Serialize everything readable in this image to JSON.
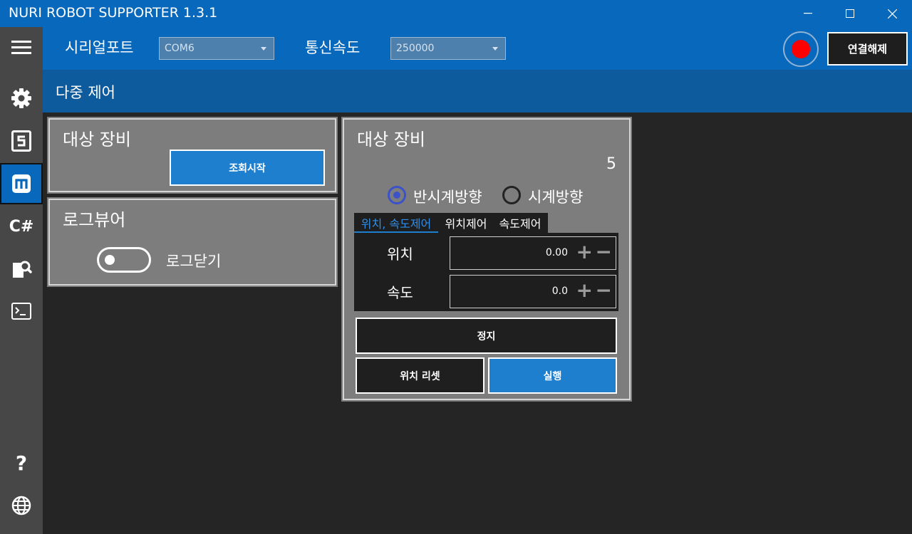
{
  "app": {
    "title": "NURI ROBOT SUPPORTER 1.3.1"
  },
  "window_controls": {
    "minimize": "—",
    "maximize": "☐",
    "close": "✕"
  },
  "sidebar": {
    "items": [
      {
        "name": "menu-icon",
        "glyph": "☰"
      },
      {
        "name": "gear-icon",
        "glyph": "⚙"
      },
      {
        "name": "s-icon",
        "glyph": "S"
      },
      {
        "name": "m-icon",
        "glyph": "m"
      },
      {
        "name": "csharp-icon",
        "glyph": "C#"
      },
      {
        "name": "file-search-icon",
        "glyph": "🔍"
      },
      {
        "name": "terminal-icon",
        "glyph": ">_"
      },
      {
        "name": "help-icon",
        "glyph": "?"
      },
      {
        "name": "globe-icon",
        "glyph": "🌐"
      }
    ],
    "active_index": 3,
    "csharp_label": "C#",
    "help_label": "?"
  },
  "connection": {
    "serial_port_label": "시리얼포트",
    "serial_port_value": "COM6",
    "baud_label": "통신속도",
    "baud_value": "250000",
    "status_color": "#ff0000",
    "disconnect_label": "연결해제"
  },
  "page": {
    "title": "다중 제어"
  },
  "target_panel": {
    "title": "대상 장비",
    "scan_button": "조회시작"
  },
  "log_panel": {
    "title": "로그뷰어",
    "toggle_label": "로그닫기",
    "toggle_on": false
  },
  "control_panel": {
    "title": "대상 장비",
    "device_count": "5",
    "direction": {
      "ccw_label": "반시계방향",
      "cw_label": "시계방향",
      "selected": "ccw"
    },
    "tabs": [
      {
        "label": "위치, 속도제어",
        "active": true
      },
      {
        "label": "위치제어",
        "active": false
      },
      {
        "label": "속도제어",
        "active": false
      }
    ],
    "position": {
      "label": "위치",
      "value": "0.00"
    },
    "speed": {
      "label": "속도",
      "value": "0.0"
    },
    "plus": "+",
    "minus": "−",
    "stop_button": "정지",
    "reset_button": "위치 리셋",
    "run_button": "실행"
  },
  "colors": {
    "title_bar": "#0868bb",
    "header_bar": "#0d5a9d",
    "panel": "#7d7d7d",
    "accent_blue": "#1f7fcf",
    "background": "#252525"
  }
}
